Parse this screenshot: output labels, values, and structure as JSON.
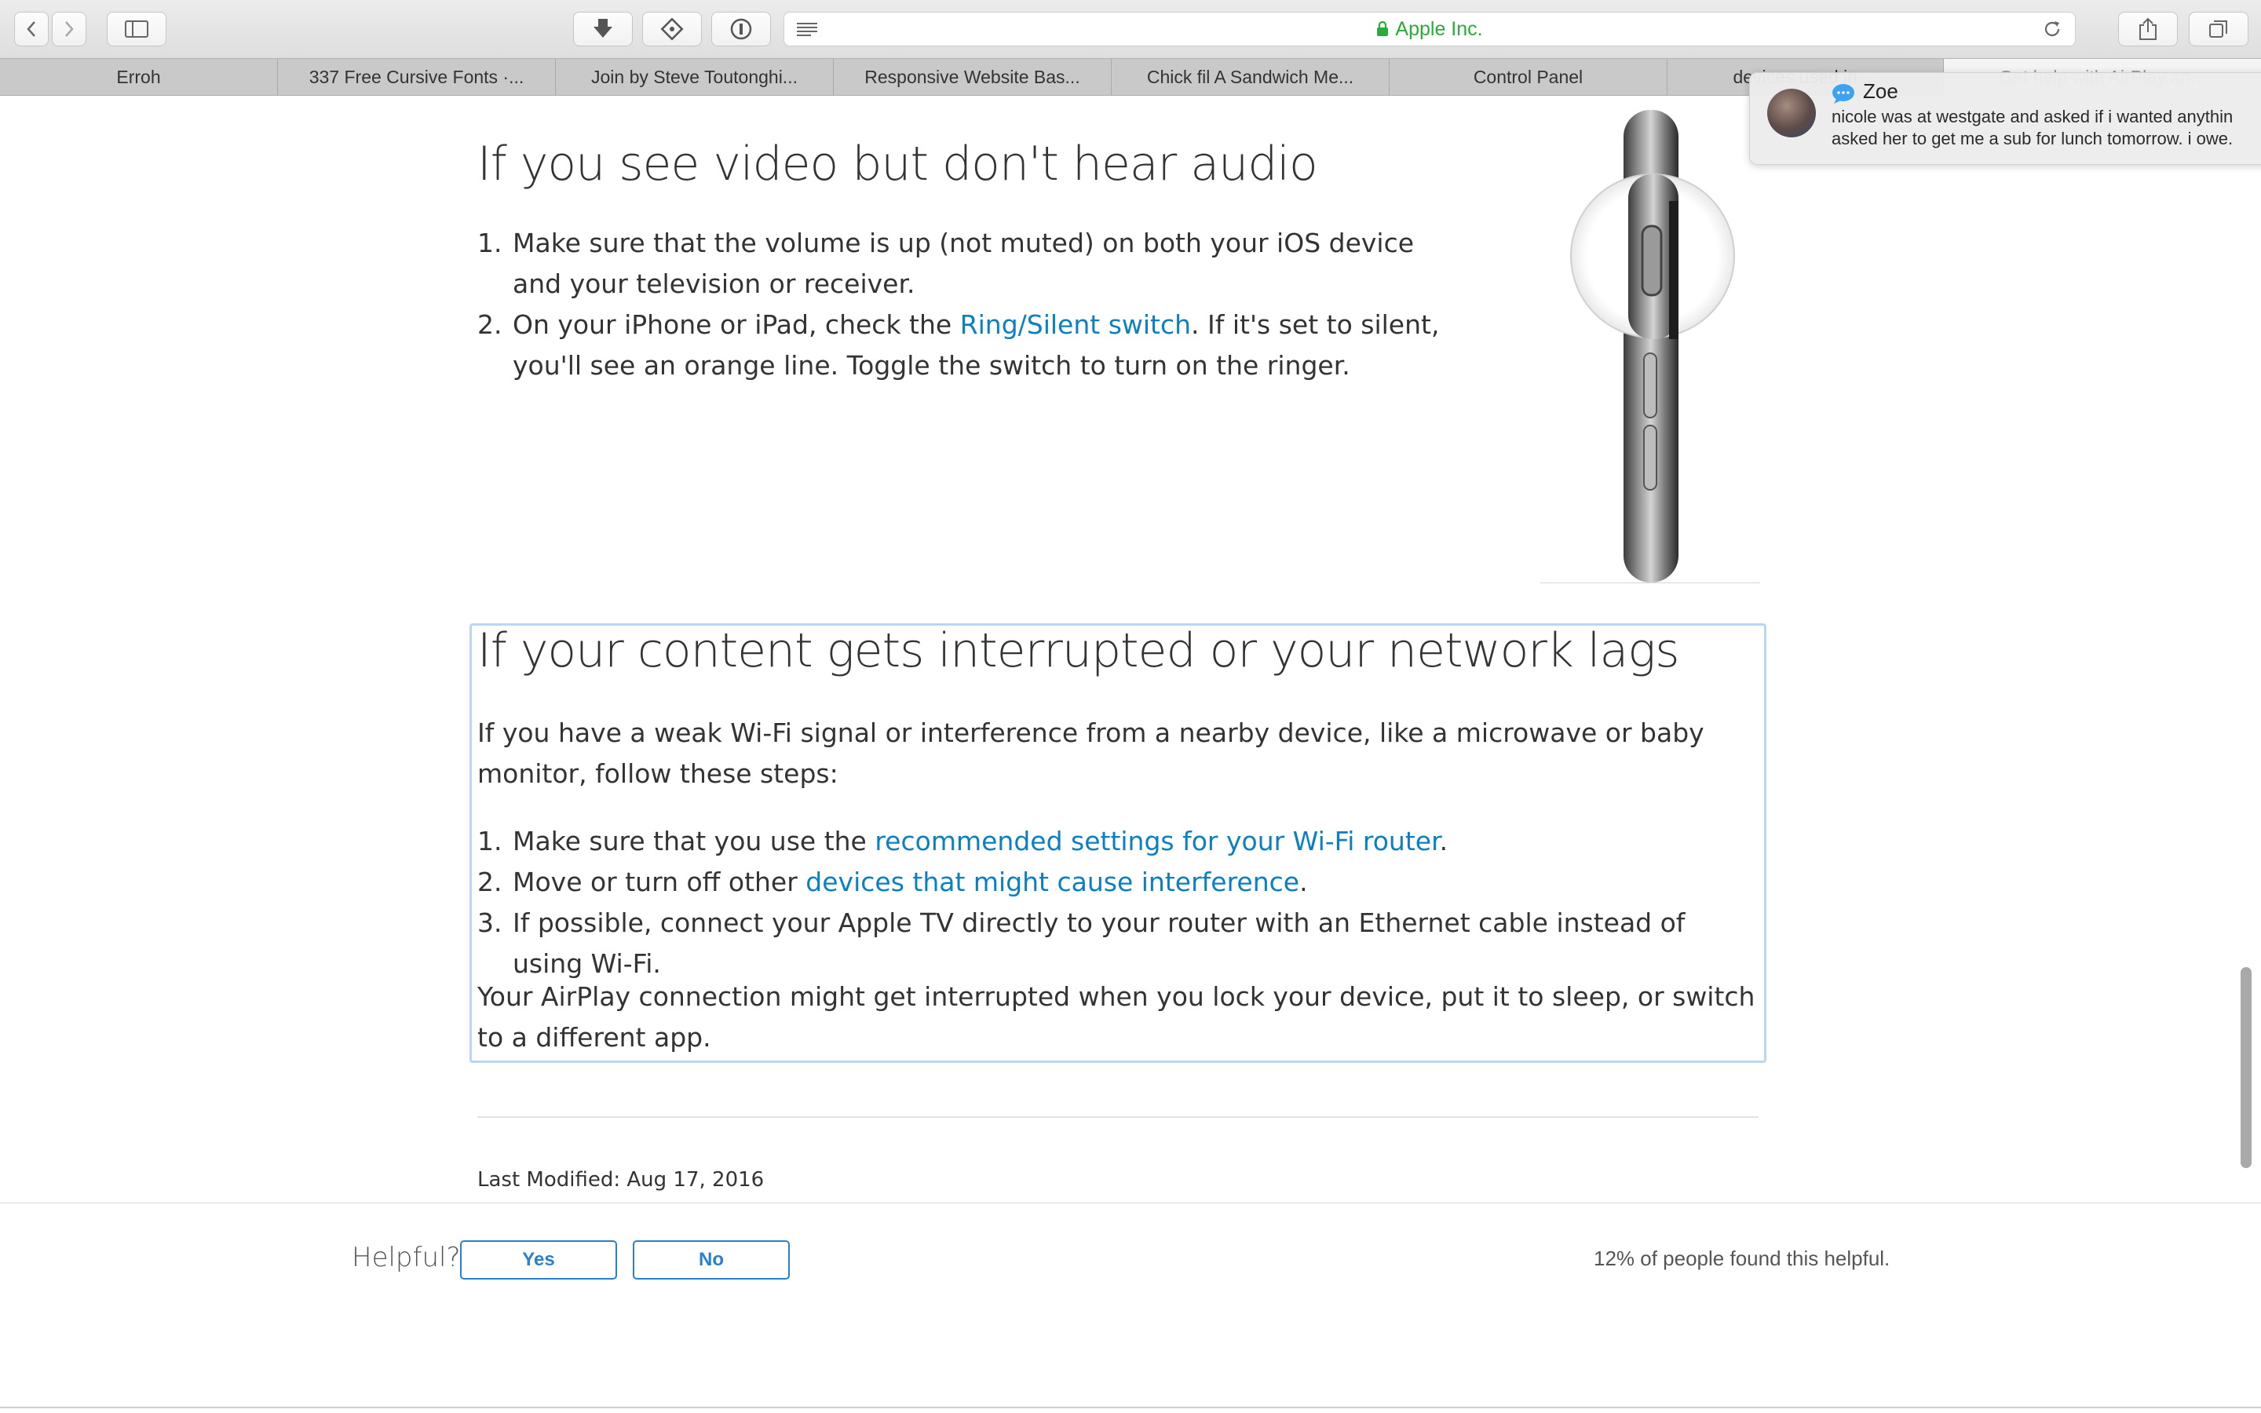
{
  "toolbar": {
    "address_host": "Apple Inc.",
    "icons": [
      "back-icon",
      "forward-icon",
      "sidebar-icon",
      "downloads-icon",
      "extension-icon",
      "password-icon",
      "reader-icon",
      "lock-icon",
      "reload-icon",
      "share-icon",
      "tabs-icon"
    ],
    "accent_green": "#2bab3a"
  },
  "tabs": [
    {
      "label": "Erroh"
    },
    {
      "label": "337 Free Cursive Fonts ·..."
    },
    {
      "label": "Join by Steve Toutonghi..."
    },
    {
      "label": "Responsive Website Bas..."
    },
    {
      "label": "Chick fil A Sandwich Me..."
    },
    {
      "label": "Control Panel"
    },
    {
      "label": "devices used in ..."
    },
    {
      "label": "Get help with AirPlay an..."
    }
  ],
  "notification": {
    "sender": "Zoe",
    "message_line1": "nicole was at westgate and asked if i wanted anythin",
    "message_line2": "asked her to get me a sub for lunch tomorrow. i owe."
  },
  "section_audio": {
    "heading": "If you see video but don't hear audio",
    "steps": [
      {
        "num": "1.",
        "text": "Make sure that the volume is up (not muted) on both your iOS device and your television or receiver."
      },
      {
        "num": "2.",
        "before": "On your iPhone or iPad, check the ",
        "link": "Ring/Silent switch",
        "after": ". If it's set to silent, you'll see an orange line. Toggle the switch to turn on the ringer."
      }
    ]
  },
  "section_network": {
    "heading": "If your content gets interrupted or your network lags",
    "intro": "If you have a weak Wi-Fi signal or interference from a nearby device, like a microwave or baby monitor, follow these steps:",
    "steps": [
      {
        "num": "1.",
        "before": "Make sure that you use the ",
        "link": "recommended settings for your Wi-Fi router",
        "after": "."
      },
      {
        "num": "2.",
        "before": "Move or turn off other ",
        "link": "devices that might cause interference",
        "after": "."
      },
      {
        "num": "3.",
        "text": "If possible, connect your Apple TV directly to your router with an Ethernet cable instead of using Wi-Fi."
      }
    ],
    "outro": "Your AirPlay connection might get interrupted when you lock your device, put it to sleep, or switch to a different app."
  },
  "last_modified": "Last Modified: Aug 17, 2016",
  "feedback": {
    "label": "Helpful?",
    "yes": "Yes",
    "no": "No",
    "stat": "12% of people found this helpful."
  },
  "colors": {
    "link": "#0a7fc2",
    "button_blue": "#2b7fcf",
    "focus_outline": "#b9d6f7"
  }
}
